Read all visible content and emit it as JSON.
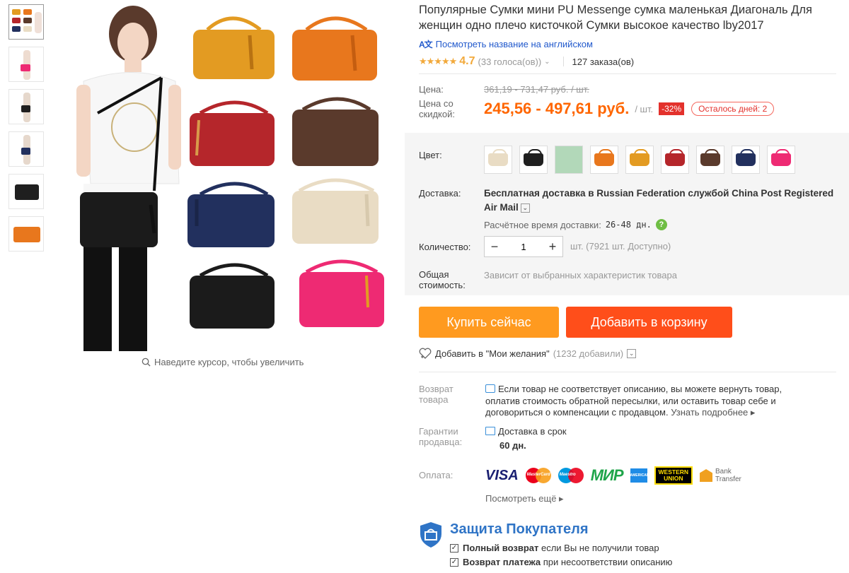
{
  "product": {
    "title": "Популярные Сумки мини PU Messenge сумка маленькая Диагональ Для женщин одно плечо кисточкой Сумки высокое качество lby2017",
    "translate_link": "Посмотреть название на английском",
    "rating": "4.7",
    "votes": "(33 голоса(ов))",
    "orders": "127 заказа(ов)",
    "stars": "★★★★★"
  },
  "gallery": {
    "zoom_hint": "Наведите курсор, чтобы увеличить"
  },
  "price": {
    "label": "Цена:",
    "old": "361,19 - 731,47 руб. / шт.",
    "discount_label": "Цена со скидкой:",
    "new": "245,56 - 497,61 руб.",
    "unit": "/ шт.",
    "discount": "-32%",
    "days_left": "Осталось дней: 2"
  },
  "colors": {
    "label": "Цвет:",
    "swatches": [
      "#e9dcc4",
      "#1f1f1f",
      "#b2d8b9",
      "#e8771d",
      "#e39b22",
      "#b5262b",
      "#5a3a2c",
      "#22305e",
      "#ee2a73"
    ]
  },
  "shipping": {
    "label": "Доставка:",
    "main": "Бесплатная доставка в Russian Federation службой China Post Registered Air Mail",
    "time_label": "Расчётное время доставки:",
    "time_value": "26-48 дн."
  },
  "quantity": {
    "label": "Количество:",
    "value": "1",
    "info": "шт. (7921 шт. Доступно)"
  },
  "total": {
    "label": "Общая стоимость:",
    "text": "Зависит от выбранных характеристик товара"
  },
  "actions": {
    "buy": "Купить сейчас",
    "cart": "Добавить в корзину",
    "wish": "Добавить в \"Мои желания\"",
    "wish_count": "(1232 добавили)"
  },
  "returns": {
    "label": "Возврат товара",
    "text": "Если товар не соответствует описанию, вы можете вернуть товар, оплатив стоимость обратной пересылки, или оставить товар себе и договориться о компенсации с продавцом.",
    "more": "Узнать подробнее ▸"
  },
  "guarantee": {
    "label": "Гарантии продавца:",
    "text": "Доставка в срок",
    "days": "60 дн."
  },
  "payment": {
    "label": "Оплата:",
    "visa": "VISA",
    "mastercard": "MasterCard",
    "maestro": "Maestro",
    "mir": "МИР",
    "amex": "AMERICAN EXPRESS",
    "wu_line1": "WESTERN",
    "wu_line2": "UNION",
    "bank_line1": "Bank",
    "bank_line2": "Transfer",
    "see_more": "Посмотреть ещё ▸"
  },
  "protection": {
    "title": "Защита Покупателя",
    "item1_bold": "Полный возврат",
    "item1_rest": "если Вы не получили товар",
    "item2_bold": "Возврат платежа",
    "item2_rest": "при несоответствии описанию"
  }
}
